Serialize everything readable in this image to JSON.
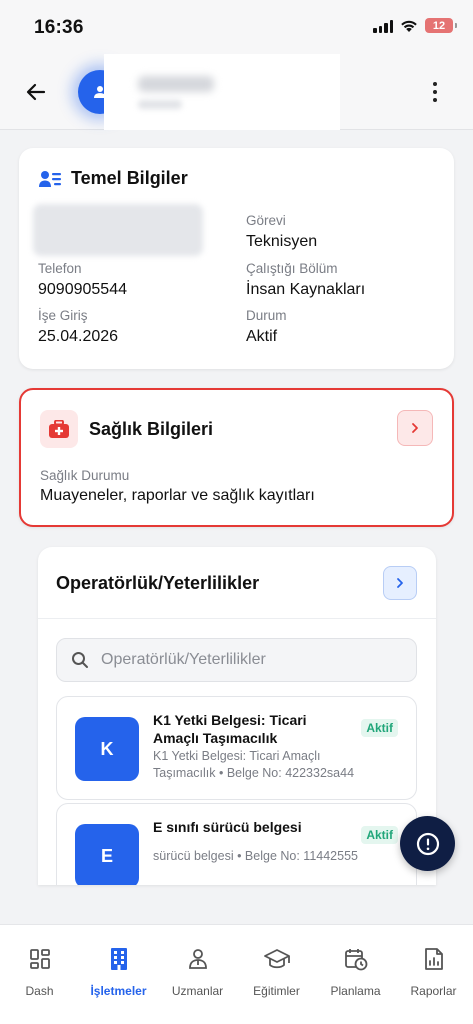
{
  "status_bar": {
    "time": "16:36",
    "battery": "12"
  },
  "header": {
    "back_icon": "arrow-left-icon",
    "more_icon": "more-vertical-icon"
  },
  "basic_info": {
    "title": "Temel Bilgiler",
    "icon": "user-list-icon",
    "fields": [
      {
        "label": "Görevi",
        "value": "Teknisyen"
      },
      {
        "label": "Telefon",
        "value": "9090905544"
      },
      {
        "label": "Çalıştığı Bölüm",
        "value": "İnsan Kaynakları"
      },
      {
        "label": "İşe Giriş",
        "value": "25.04.2026"
      },
      {
        "label": "Durum",
        "value": "Aktif"
      }
    ]
  },
  "health": {
    "title": "Sağlık Bilgileri",
    "icon": "medical-kit-icon",
    "label": "Sağlık Durumu",
    "value": "Muayeneler, raporlar ve sağlık kayıtları",
    "accent": "#e53935"
  },
  "operator": {
    "title": "Operatörlük/Yeterlilikler",
    "search_placeholder": "Operatörlük/Yeterlilikler",
    "items": [
      {
        "badge": "K",
        "title": "K1 Yetki Belgesi: Ticari Amaçlı Taşımacılık",
        "subtitle": "K1 Yetki Belgesi: Ticari Amaçlı Taşımacılık • Belge No: 422332sa44",
        "status": "Aktif"
      },
      {
        "badge": "E",
        "title": "E sınıfı sürücü belgesi",
        "subtitle": "sürücü belgesi • Belge No: 11442555",
        "status": "Aktif"
      }
    ]
  },
  "tabs": [
    {
      "label": "Dash",
      "icon": "dashboard-icon",
      "active": false
    },
    {
      "label": "İşletmeler",
      "icon": "building-icon",
      "active": true
    },
    {
      "label": "Uzmanlar",
      "icon": "expert-icon",
      "active": false
    },
    {
      "label": "Eğitimler",
      "icon": "graduation-cap-icon",
      "active": false
    },
    {
      "label": "Planlama",
      "icon": "calendar-clock-icon",
      "active": false
    },
    {
      "label": "Raporlar",
      "icon": "report-icon",
      "active": false
    }
  ],
  "colors": {
    "primary": "#2563eb",
    "fab": "#0f1e44",
    "success": "#21a67a"
  }
}
